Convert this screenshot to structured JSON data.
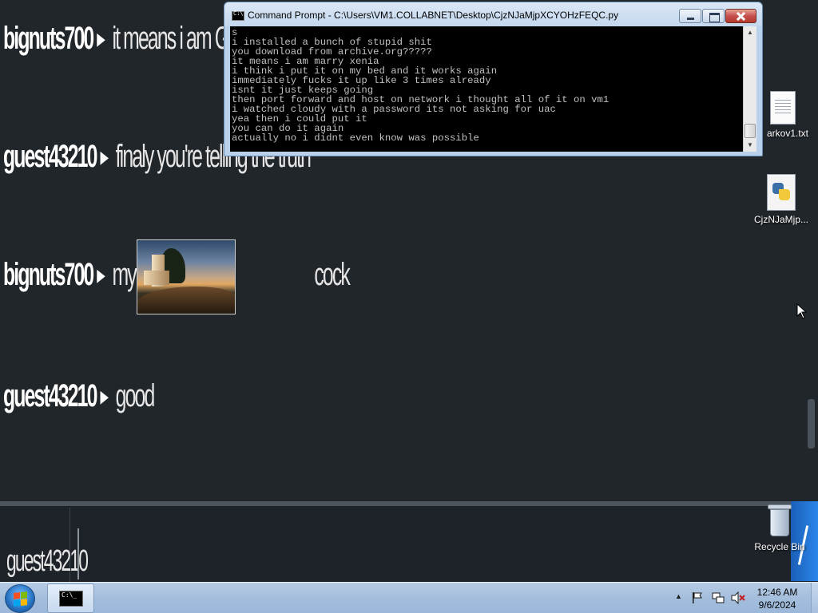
{
  "chat": {
    "messages": [
      {
        "user": "bignuts700",
        "text": "it means i am GAY"
      },
      {
        "user": "guest43210",
        "text": "finaly you're telling the truth"
      },
      {
        "user": "bignuts700",
        "text_before": "my mother is",
        "text_after": "cock",
        "image": "lighthouse-photo"
      },
      {
        "user": "guest43210",
        "text": "good"
      }
    ],
    "arrow_icon": "triangle-right-icon"
  },
  "input": {
    "current_user": "guest43210",
    "value": ""
  },
  "cmd": {
    "title": "Command Prompt - C:\\Users\\VM1.COLLABNET\\Desktop\\CjzNJaMjpXCYOHzFEQC.py",
    "lines": [
      "s",
      "i installed a bunch of stupid shit",
      "you download from archive.org?????",
      "it means i am marry xenia",
      "i think i put it on my bed and it works again",
      "immediately fucks it up like 3 times already",
      "isnt it just keeps going",
      "then port forward and host on network i thought all of it on vm1",
      "i watched cloudy with a password its not asking for uac",
      "yea then i could put it",
      "you can do it again",
      "actually no i didnt even know was possible"
    ]
  },
  "desktop": {
    "icons": [
      {
        "label": "arkov1.txt",
        "icon": "text-file-icon"
      },
      {
        "label": "CjzNJaMjp...",
        "icon": "python-file-icon"
      },
      {
        "label": "Recycle Bin",
        "icon": "recycle-bin-icon"
      }
    ]
  },
  "taskbar": {
    "start_icon": "windows-start-icon",
    "task_icon": "command-prompt-icon",
    "clock_time": "12:46 AM",
    "clock_date": "9/6/2024"
  },
  "colors": {
    "chat_background": "#21262b",
    "console_background": "#000000",
    "console_text": "#c0c0c0",
    "taskbar": "#a4bedc"
  }
}
